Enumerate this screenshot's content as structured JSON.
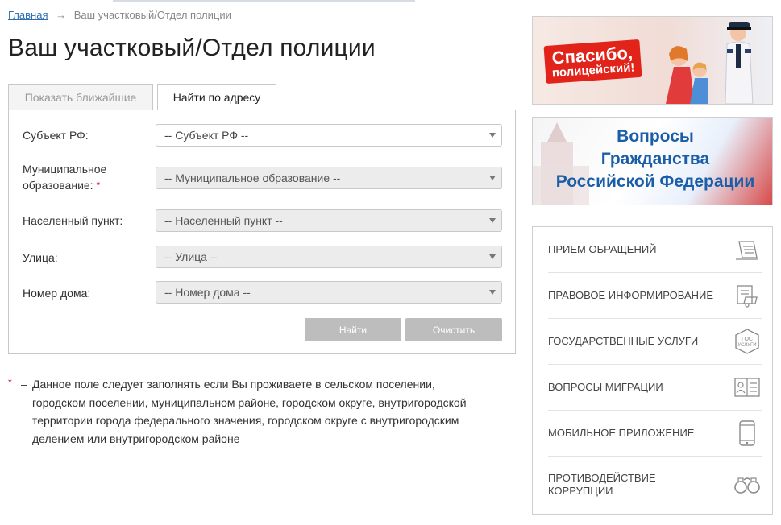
{
  "breadcrumb": {
    "home": "Главная",
    "separator": "→",
    "current": "Ваш участковый/Отдел полиции"
  },
  "page": {
    "title": "Ваш участковый/Отдел полиции"
  },
  "tabs": [
    {
      "label": "Показать ближайшие",
      "active": false
    },
    {
      "label": "Найти по адресу",
      "active": true
    }
  ],
  "form": {
    "required_mark": "*",
    "fields": [
      {
        "label": "Субъект РФ:",
        "value": "-- Субъект РФ --",
        "enabled": true,
        "required": false
      },
      {
        "label_line1": "Муниципальное",
        "label_line2": "образование:",
        "value": "-- Муниципальное образование --",
        "enabled": false,
        "required": true
      },
      {
        "label": "Населенный пункт:",
        "value": "-- Населенный пункт --",
        "enabled": false,
        "required": false
      },
      {
        "label": "Улица:",
        "value": "-- Улица --",
        "enabled": false,
        "required": false
      },
      {
        "label": "Номер дома:",
        "value": "-- Номер дома --",
        "enabled": false,
        "required": false
      }
    ],
    "find_label": "Найти",
    "clear_label": "Очистить"
  },
  "footnote": {
    "star": "*",
    "dash": "–",
    "line1": "Данное поле следует заполнять если Вы проживаете в сельском поселении,",
    "line2": "городском поселении, муниципальном районе, городском округе, внутригородской",
    "line3": "территории города федерального значения, городском округе с внутригородским",
    "line4": "делением или внутригородском районе"
  },
  "banners": {
    "thanks_line1": "Спасибо,",
    "thanks_line2": "полицейский!",
    "citizen_line1": "Вопросы",
    "citizen_line2": "Гражданства",
    "citizen_line3": "Российской Федерации"
  },
  "side_menu": {
    "items": [
      {
        "label": "Прием обращений",
        "icon": "document-pen-icon"
      },
      {
        "label": "Правовое информирование",
        "icon": "papers-icon"
      },
      {
        "label": "Государственные услуги",
        "icon": "gosuslugi-icon"
      },
      {
        "label": "Вопросы миграции",
        "icon": "passport-icon"
      },
      {
        "label": "Мобильное приложение",
        "icon": "smartphone-icon"
      },
      {
        "label_line1": "Противодействие",
        "label_line2": "коррупции",
        "icon": "handcuffs-icon"
      }
    ]
  },
  "colors": {
    "link": "#2f6fb0",
    "required": "#d0021b",
    "button": "#bdbdbd",
    "banner_red": "#e2231a",
    "banner_blue": "#1a5ea8"
  }
}
